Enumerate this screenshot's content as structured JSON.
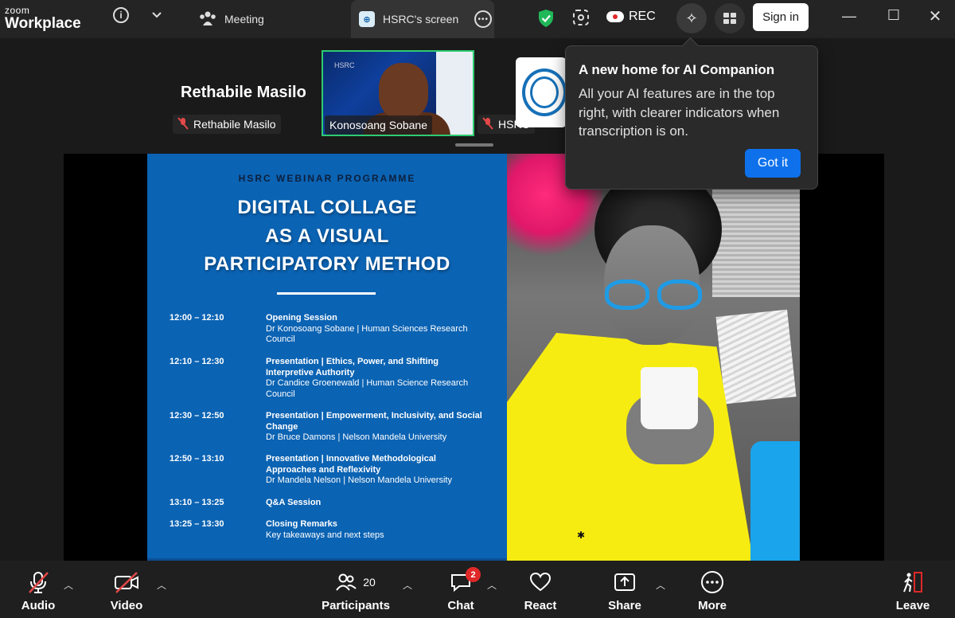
{
  "app": {
    "brand_top": "zoom",
    "brand_bottom": "Workplace"
  },
  "titlebar": {
    "meeting_tab": "Meeting",
    "screen_tab": "HSRC's screen",
    "screen_tab_logo": "HSRC",
    "rec_label": "REC",
    "signin_label": "Sign in"
  },
  "participants_strip": {
    "featured_name": "Rethabile Masilo",
    "tiles": [
      {
        "name": "Rethabile Masilo",
        "muted": true
      },
      {
        "name": "Konosoang Sobane",
        "muted": false,
        "active_speaker": true
      },
      {
        "name": "HSRC",
        "muted": true
      }
    ],
    "video_tile_mark": "HSRC"
  },
  "tooltip": {
    "title": "A new home for AI Companion",
    "body": "All your AI features are in the top right, with clearer indicators when transcription is on.",
    "button": "Got it"
  },
  "slide": {
    "programme": "HSRC WEBINAR PROGRAMME",
    "title_lines": [
      "DIGITAL COLLAGE",
      "AS A VISUAL",
      "PARTICIPATORY METHOD"
    ],
    "agenda": [
      {
        "time": "12:00 – 12:10",
        "title": "Opening Session",
        "desc": "Dr Konosoang Sobane | Human Sciences Research Council"
      },
      {
        "time": "12:10 – 12:30",
        "title": "Presentation | Ethics, Power, and Shifting Interpretive Authority",
        "desc": "Dr Candice Groenewald | Human Science Research Council"
      },
      {
        "time": "12:30 – 12:50",
        "title": "Presentation | Empowerment, Inclusivity, and Social Change",
        "desc": "Dr Bruce Damons | Nelson Mandela University"
      },
      {
        "time": "12:50 – 13:10",
        "title": "Presentation | Innovative Methodological Approaches and Reflexivity",
        "desc": "Dr Mandela Nelson | Nelson Mandela University"
      },
      {
        "time": "13:10 – 13:25",
        "title": "Q&A Session",
        "desc": ""
      },
      {
        "time": "13:25 – 13:30",
        "title": "Closing Remarks",
        "desc": "Key takeaways and next steps"
      }
    ]
  },
  "toolbar": {
    "audio": "Audio",
    "video": "Video",
    "participants": "Participants",
    "participants_count": "20",
    "chat": "Chat",
    "chat_badge": "2",
    "react": "React",
    "share": "Share",
    "more": "More",
    "leave": "Leave"
  },
  "colors": {
    "accent": "#0e71eb",
    "muted_red": "#e34848",
    "active_speaker": "#2ecc71",
    "slide_blue": "#0b63b3",
    "leave_red": "#e02828"
  },
  "icons": [
    "info-icon",
    "chevron-down-icon",
    "participants-icon",
    "shield-icon",
    "ai-sparkle-icon",
    "apps-icon",
    "minimize-icon",
    "maximize-icon",
    "close-icon",
    "mic-off-icon",
    "video-off-icon",
    "chat-icon",
    "heart-icon",
    "share-up-icon",
    "more-dots-icon",
    "leave-icon"
  ]
}
